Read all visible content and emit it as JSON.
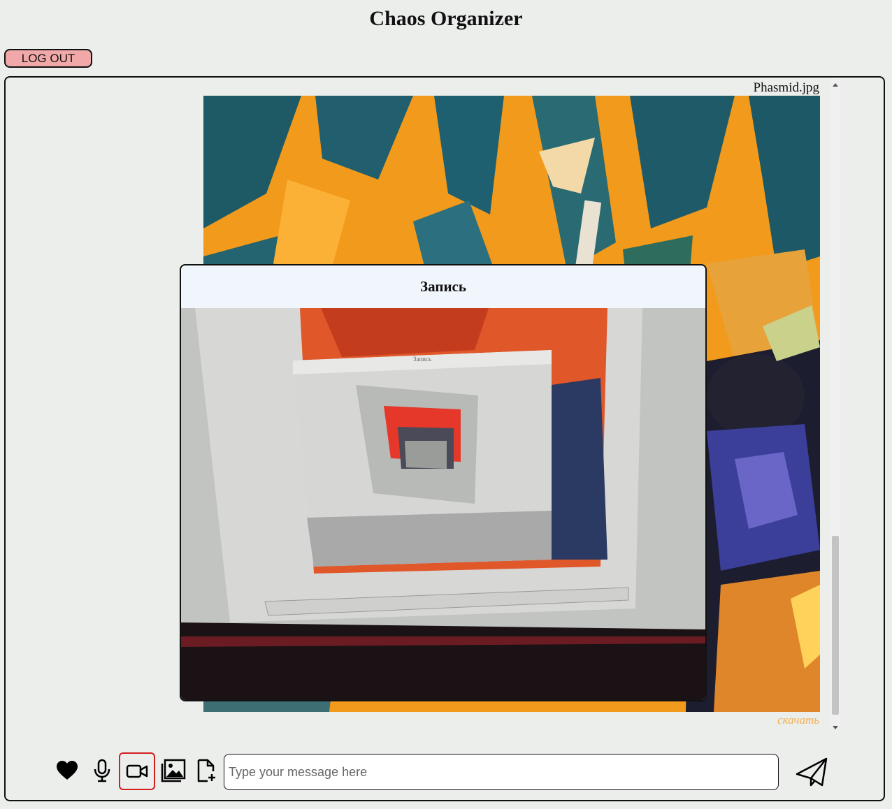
{
  "app": {
    "title": "Chaos Organizer"
  },
  "header": {
    "logout_label": "LOG OUT"
  },
  "feed": {
    "messages": [
      {
        "filename": "Phasmid.jpg",
        "download_label": "скачать"
      }
    ]
  },
  "modal": {
    "title": "Запись",
    "video_screen_label": "Запись"
  },
  "toolbar": {
    "icons": [
      "heart-icon",
      "microphone-icon",
      "video-camera-icon",
      "image-icon",
      "file-add-icon"
    ],
    "active_tool": "video-camera-icon",
    "message_placeholder": "Type your message here",
    "message_value": "",
    "send_icon": "paper-plane-icon"
  },
  "colors": {
    "logout_bg": "#f0a8a8",
    "active_tool_border": "#d21f1f",
    "download_link": "#f0b050",
    "modal_header_bg": "#f0f6fc"
  }
}
